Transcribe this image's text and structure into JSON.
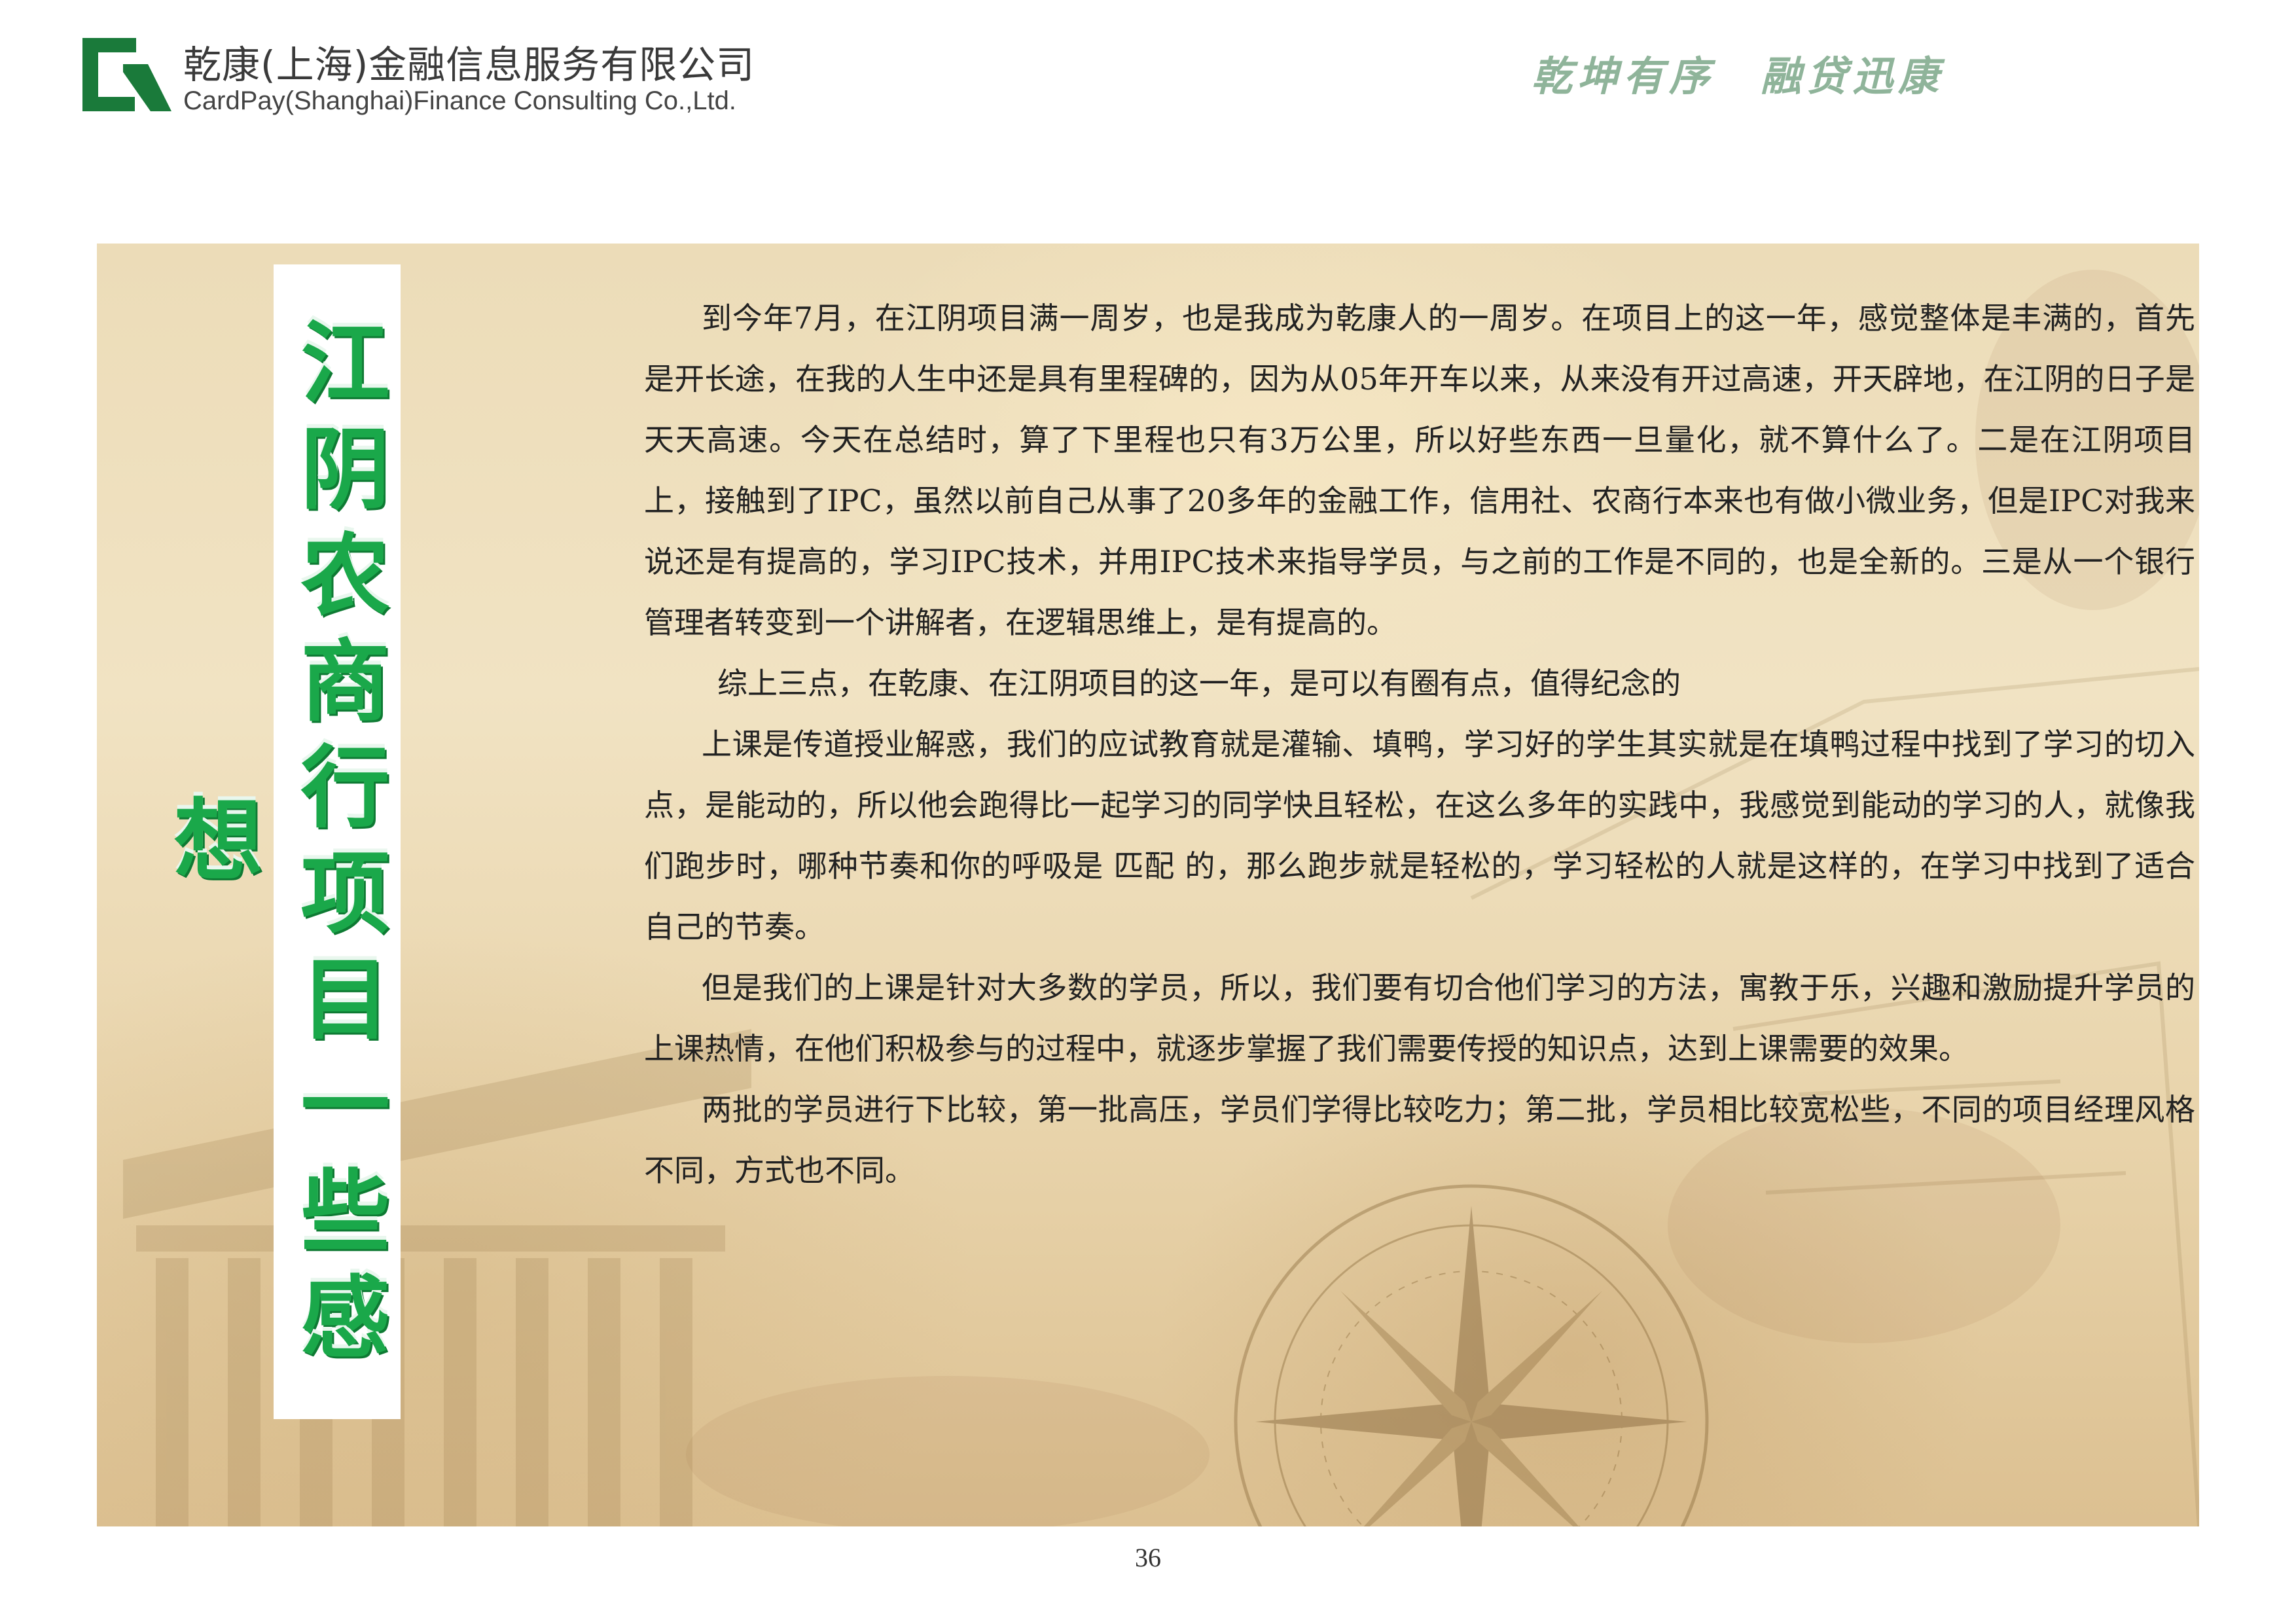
{
  "header": {
    "company_name_cn": "乾康(上海)金融信息服务有限公司",
    "company_name_en": "CardPay(Shanghai)Finance Consulting Co.,Ltd.",
    "slogan": "乾坤有序　融贷迅康",
    "logo_icon": "company-logo-icon",
    "brand_color": "#1a7a3a"
  },
  "banner": {
    "title": "江阴农商行项目一些感想",
    "color": "#1aa84a"
  },
  "paragraphs": [
    "到今年7月，在江阴项目满一周岁，也是我成为乾康人的一周岁。在项目上的这一年，感觉整体是丰满的，首先是开长途，在我的人生中还是具有里程碑的，因为从05年开车以来，从来没有开过高速，开天辟地，在江阴的日子是天天高速。今天在总结时，算了下里程也只有3万公里，所以好些东西一旦量化，就不算什么了。二是在江阴项目上，接触到了IPC，虽然以前自己从事了20多年的金融工作，信用社、农商行本来也有做小微业务，但是IPC对我来说还是有提高的，学习IPC技术，并用IPC技术来指导学员，与之前的工作是不同的，也是全新的。三是从一个银行管理者转变到一个讲解者，在逻辑思维上，是有提高的。",
    "综上三点，在乾康、在江阴项目的这一年，是可以有圈有点，值得纪念的",
    "上课是传道授业解惑，我们的应试教育就是灌输、填鸭，学习好的学生其实就是在填鸭过程中找到了学习的切入点，是能动的，所以他会跑得比一起学习的同学快且轻松，在这么多年的实践中，我感觉到能动的学习的人，就像我们跑步时，哪种节奏和你的呼吸是 匹配 的，那么跑步就是轻松的，学习轻松的人就是这样的，在学习中找到了适合自己的节奏。",
    "但是我们的上课是针对大多数的学员，所以，我们要有切合他们学习的方法，寓教于乐，兴趣和激励提升学员的上课热情，在他们积极参与的过程中，就逐步掌握了我们需要传授的知识点，达到上课需要的效果。",
    "两批的学员进行下比较，第一批高压，学员们学得比较吃力；第二批，学员相比较宽松些，不同的项目经理风格不同，方式也不同。"
  ],
  "footer": {
    "page_number": "36"
  }
}
